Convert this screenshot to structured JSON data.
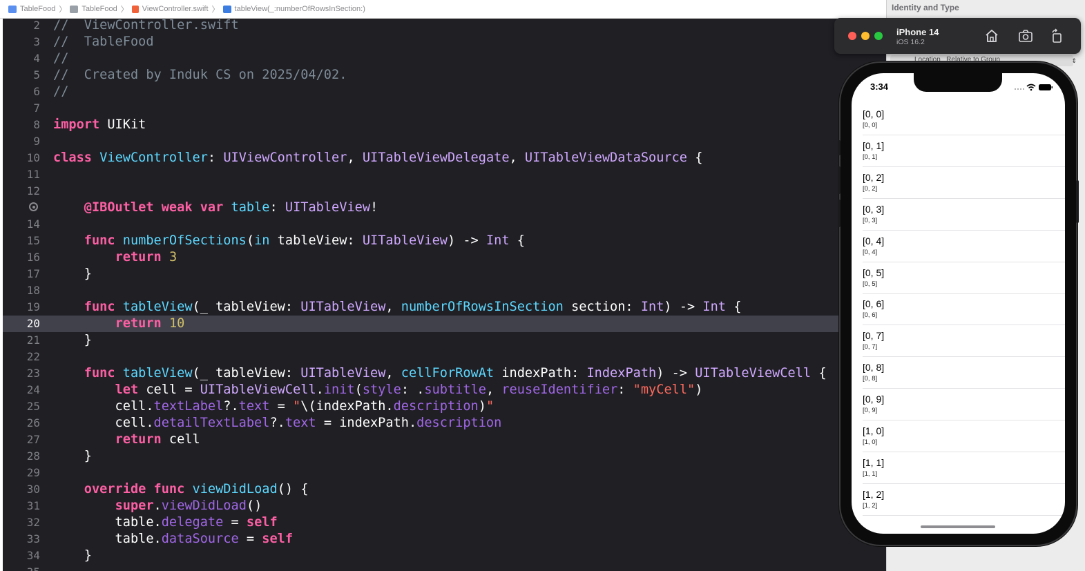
{
  "breadcrumb": [
    {
      "label": "TableFood",
      "icon": "xcode-project-icon"
    },
    {
      "label": "TableFood",
      "icon": "folder-icon"
    },
    {
      "label": "ViewController.swift",
      "icon": "swift-file-icon"
    },
    {
      "label": "tableView(_:numberOfRowsInSection:)",
      "icon": "method-icon"
    }
  ],
  "editor": {
    "current_line": "20",
    "lines": [
      {
        "n": "2",
        "tokens": [
          [
            "cm",
            "//  ViewController.swift"
          ]
        ]
      },
      {
        "n": "3",
        "tokens": [
          [
            "cm",
            "//  TableFood"
          ]
        ]
      },
      {
        "n": "4",
        "tokens": [
          [
            "cm",
            "//"
          ]
        ]
      },
      {
        "n": "5",
        "tokens": [
          [
            "cm",
            "//  Created by Induk CS on 2025/04/02."
          ]
        ]
      },
      {
        "n": "6",
        "tokens": [
          [
            "cm",
            "//"
          ]
        ]
      },
      {
        "n": "7",
        "tokens": []
      },
      {
        "n": "8",
        "tokens": [
          [
            "kw",
            "import"
          ],
          [
            "pl",
            " UIKit"
          ]
        ]
      },
      {
        "n": "9",
        "tokens": []
      },
      {
        "n": "10",
        "tokens": [
          [
            "kw",
            "class"
          ],
          [
            "pl",
            " "
          ],
          [
            "fn",
            "ViewController"
          ],
          [
            "pl",
            ": "
          ],
          [
            "ty",
            "UIViewController"
          ],
          [
            "pl",
            ", "
          ],
          [
            "ty",
            "UITableViewDelegate"
          ],
          [
            "pl",
            ", "
          ],
          [
            "ty",
            "UITableViewDataSource"
          ],
          [
            "pl",
            " {"
          ]
        ]
      },
      {
        "n": "11",
        "tokens": []
      },
      {
        "n": "12",
        "tokens": []
      },
      {
        "n": "13",
        "breakpoint": true,
        "tokens": [
          [
            "pl",
            "    "
          ],
          [
            "kw",
            "@IBOutlet"
          ],
          [
            "pl",
            " "
          ],
          [
            "kw",
            "weak"
          ],
          [
            "pl",
            " "
          ],
          [
            "kw",
            "var"
          ],
          [
            "pl",
            " "
          ],
          [
            "fn",
            "table"
          ],
          [
            "pl",
            ": "
          ],
          [
            "ty",
            "UITableView"
          ],
          [
            "pl",
            "!"
          ]
        ]
      },
      {
        "n": "14",
        "tokens": []
      },
      {
        "n": "15",
        "tokens": [
          [
            "pl",
            "    "
          ],
          [
            "kw",
            "func"
          ],
          [
            "pl",
            " "
          ],
          [
            "fn",
            "numberOfSections"
          ],
          [
            "pl",
            "("
          ],
          [
            "fn",
            "in"
          ],
          [
            "pl",
            " tableView: "
          ],
          [
            "ty",
            "UITableView"
          ],
          [
            "pl",
            ") -> "
          ],
          [
            "ty",
            "Int"
          ],
          [
            "pl",
            " {"
          ]
        ]
      },
      {
        "n": "16",
        "tokens": [
          [
            "pl",
            "        "
          ],
          [
            "kw",
            "return"
          ],
          [
            "pl",
            " "
          ],
          [
            "nu",
            "3"
          ]
        ]
      },
      {
        "n": "17",
        "tokens": [
          [
            "pl",
            "    }"
          ]
        ]
      },
      {
        "n": "18",
        "tokens": []
      },
      {
        "n": "19",
        "tokens": [
          [
            "pl",
            "    "
          ],
          [
            "kw",
            "func"
          ],
          [
            "pl",
            " "
          ],
          [
            "fn",
            "tableView"
          ],
          [
            "pl",
            "(_ tableView: "
          ],
          [
            "ty",
            "UITableView"
          ],
          [
            "pl",
            ", "
          ],
          [
            "fn",
            "numberOfRowsInSection"
          ],
          [
            "pl",
            " section: "
          ],
          [
            "ty",
            "Int"
          ],
          [
            "pl",
            ") -> "
          ],
          [
            "ty",
            "Int"
          ],
          [
            "pl",
            " {"
          ]
        ]
      },
      {
        "n": "20",
        "tokens": [
          [
            "pl",
            "        "
          ],
          [
            "kw",
            "return"
          ],
          [
            "pl",
            " "
          ],
          [
            "nu",
            "10"
          ]
        ]
      },
      {
        "n": "21",
        "tokens": [
          [
            "pl",
            "    }"
          ]
        ]
      },
      {
        "n": "22",
        "tokens": []
      },
      {
        "n": "23",
        "tokens": [
          [
            "pl",
            "    "
          ],
          [
            "kw",
            "func"
          ],
          [
            "pl",
            " "
          ],
          [
            "fn",
            "tableView"
          ],
          [
            "pl",
            "(_ tableView: "
          ],
          [
            "ty",
            "UITableView"
          ],
          [
            "pl",
            ", "
          ],
          [
            "fn",
            "cellForRowAt"
          ],
          [
            "pl",
            " indexPath: "
          ],
          [
            "ty",
            "IndexPath"
          ],
          [
            "pl",
            ") -> "
          ],
          [
            "ty",
            "UITableViewCell"
          ],
          [
            "pl",
            " {"
          ]
        ]
      },
      {
        "n": "24",
        "tokens": [
          [
            "pl",
            "        "
          ],
          [
            "kw",
            "let"
          ],
          [
            "pl",
            " cell = "
          ],
          [
            "ty",
            "UITableViewCell"
          ],
          [
            "pl",
            "."
          ],
          [
            "pr",
            "init"
          ],
          [
            "pl",
            "("
          ],
          [
            "pr",
            "style"
          ],
          [
            "pl",
            ": ."
          ],
          [
            "pr",
            "subtitle"
          ],
          [
            "pl",
            ", "
          ],
          [
            "pr",
            "reuseIdentifier"
          ],
          [
            "pl",
            ": "
          ],
          [
            "st",
            "\"myCell\""
          ],
          [
            "pl",
            ")"
          ]
        ]
      },
      {
        "n": "25",
        "tokens": [
          [
            "pl",
            "        cell."
          ],
          [
            "pr",
            "textLabel"
          ],
          [
            "pl",
            "?."
          ],
          [
            "pr",
            "text"
          ],
          [
            "pl",
            " = "
          ],
          [
            "st",
            "\""
          ],
          [
            "pl",
            "\\(indexPath."
          ],
          [
            "pr",
            "description"
          ],
          [
            "pl",
            ")"
          ],
          [
            "st",
            "\""
          ]
        ]
      },
      {
        "n": "26",
        "tokens": [
          [
            "pl",
            "        cell."
          ],
          [
            "pr",
            "detailTextLabel"
          ],
          [
            "pl",
            "?."
          ],
          [
            "pr",
            "text"
          ],
          [
            "pl",
            " = indexPath."
          ],
          [
            "pr",
            "description"
          ]
        ]
      },
      {
        "n": "27",
        "tokens": [
          [
            "pl",
            "        "
          ],
          [
            "kw",
            "return"
          ],
          [
            "pl",
            " cell"
          ]
        ]
      },
      {
        "n": "28",
        "tokens": [
          [
            "pl",
            "    }"
          ]
        ]
      },
      {
        "n": "29",
        "tokens": []
      },
      {
        "n": "30",
        "tokens": [
          [
            "pl",
            "    "
          ],
          [
            "kw",
            "override"
          ],
          [
            "pl",
            " "
          ],
          [
            "kw",
            "func"
          ],
          [
            "pl",
            " "
          ],
          [
            "fn",
            "viewDidLoad"
          ],
          [
            "pl",
            "() {"
          ]
        ]
      },
      {
        "n": "31",
        "tokens": [
          [
            "pl",
            "        "
          ],
          [
            "kw",
            "super"
          ],
          [
            "pl",
            "."
          ],
          [
            "pr",
            "viewDidLoad"
          ],
          [
            "pl",
            "()"
          ]
        ]
      },
      {
        "n": "32",
        "tokens": [
          [
            "pl",
            "        table."
          ],
          [
            "pr",
            "delegate"
          ],
          [
            "pl",
            " = "
          ],
          [
            "kw",
            "self"
          ]
        ]
      },
      {
        "n": "33",
        "tokens": [
          [
            "pl",
            "        table."
          ],
          [
            "pr",
            "dataSource"
          ],
          [
            "pl",
            " = "
          ],
          [
            "kw",
            "self"
          ]
        ]
      },
      {
        "n": "34",
        "tokens": [
          [
            "pl",
            "    }"
          ]
        ]
      },
      {
        "n": "35",
        "tokens": []
      }
    ]
  },
  "inspector": {
    "title": "Identity and Type",
    "location_label": "Location",
    "location_value": "Relative to Group"
  },
  "simulator": {
    "device": "iPhone 14",
    "os": "iOS 16.2",
    "buttons": [
      "home-icon",
      "screenshot-icon",
      "rotate-icon"
    ],
    "status_time": "3:34",
    "rows": [
      {
        "title": "[0, 0]",
        "subtitle": "[0, 0]"
      },
      {
        "title": "[0, 1]",
        "subtitle": "[0, 1]"
      },
      {
        "title": "[0, 2]",
        "subtitle": "[0, 2]"
      },
      {
        "title": "[0, 3]",
        "subtitle": "[0, 3]"
      },
      {
        "title": "[0, 4]",
        "subtitle": "[0, 4]"
      },
      {
        "title": "[0, 5]",
        "subtitle": "[0, 5]"
      },
      {
        "title": "[0, 6]",
        "subtitle": "[0, 6]"
      },
      {
        "title": "[0, 7]",
        "subtitle": "[0, 7]"
      },
      {
        "title": "[0, 8]",
        "subtitle": "[0, 8]"
      },
      {
        "title": "[0, 9]",
        "subtitle": "[0, 9]"
      },
      {
        "title": "[1, 0]",
        "subtitle": "[1, 0]"
      },
      {
        "title": "[1, 1]",
        "subtitle": "[1, 1]"
      },
      {
        "title": "[1, 2]",
        "subtitle": "[1, 2]"
      }
    ]
  },
  "colors": {
    "editor_bg": "#1f1f24",
    "current_line_bg": "#40414b",
    "keyword": "#fc5fa3",
    "comment": "#7f8c98",
    "type": "#d0a8ff",
    "function": "#5dd8ff",
    "property": "#a167e6",
    "number": "#d0bf69",
    "string": "#fc6a5d",
    "traffic_red": "#ff5f57",
    "traffic_yellow": "#febc2e",
    "traffic_green": "#28c840"
  }
}
